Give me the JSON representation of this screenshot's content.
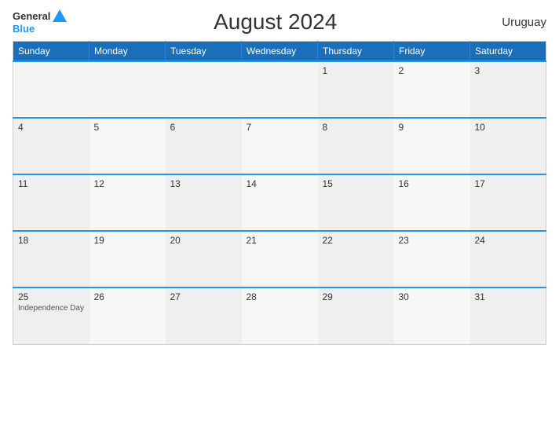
{
  "header": {
    "logo": {
      "general": "General",
      "blue": "Blue",
      "triangle_color": "#2196f3"
    },
    "title": "August 2024",
    "country": "Uruguay"
  },
  "weekdays": [
    "Sunday",
    "Monday",
    "Tuesday",
    "Wednesday",
    "Thursday",
    "Friday",
    "Saturday"
  ],
  "weeks": [
    [
      {
        "day": "",
        "event": ""
      },
      {
        "day": "",
        "event": ""
      },
      {
        "day": "",
        "event": ""
      },
      {
        "day": "",
        "event": ""
      },
      {
        "day": "1",
        "event": ""
      },
      {
        "day": "2",
        "event": ""
      },
      {
        "day": "3",
        "event": ""
      }
    ],
    [
      {
        "day": "4",
        "event": ""
      },
      {
        "day": "5",
        "event": ""
      },
      {
        "day": "6",
        "event": ""
      },
      {
        "day": "7",
        "event": ""
      },
      {
        "day": "8",
        "event": ""
      },
      {
        "day": "9",
        "event": ""
      },
      {
        "day": "10",
        "event": ""
      }
    ],
    [
      {
        "day": "11",
        "event": ""
      },
      {
        "day": "12",
        "event": ""
      },
      {
        "day": "13",
        "event": ""
      },
      {
        "day": "14",
        "event": ""
      },
      {
        "day": "15",
        "event": ""
      },
      {
        "day": "16",
        "event": ""
      },
      {
        "day": "17",
        "event": ""
      }
    ],
    [
      {
        "day": "18",
        "event": ""
      },
      {
        "day": "19",
        "event": ""
      },
      {
        "day": "20",
        "event": ""
      },
      {
        "day": "21",
        "event": ""
      },
      {
        "day": "22",
        "event": ""
      },
      {
        "day": "23",
        "event": ""
      },
      {
        "day": "24",
        "event": ""
      }
    ],
    [
      {
        "day": "25",
        "event": "Independence Day"
      },
      {
        "day": "26",
        "event": ""
      },
      {
        "day": "27",
        "event": ""
      },
      {
        "day": "28",
        "event": ""
      },
      {
        "day": "29",
        "event": ""
      },
      {
        "day": "30",
        "event": ""
      },
      {
        "day": "31",
        "event": ""
      }
    ]
  ]
}
